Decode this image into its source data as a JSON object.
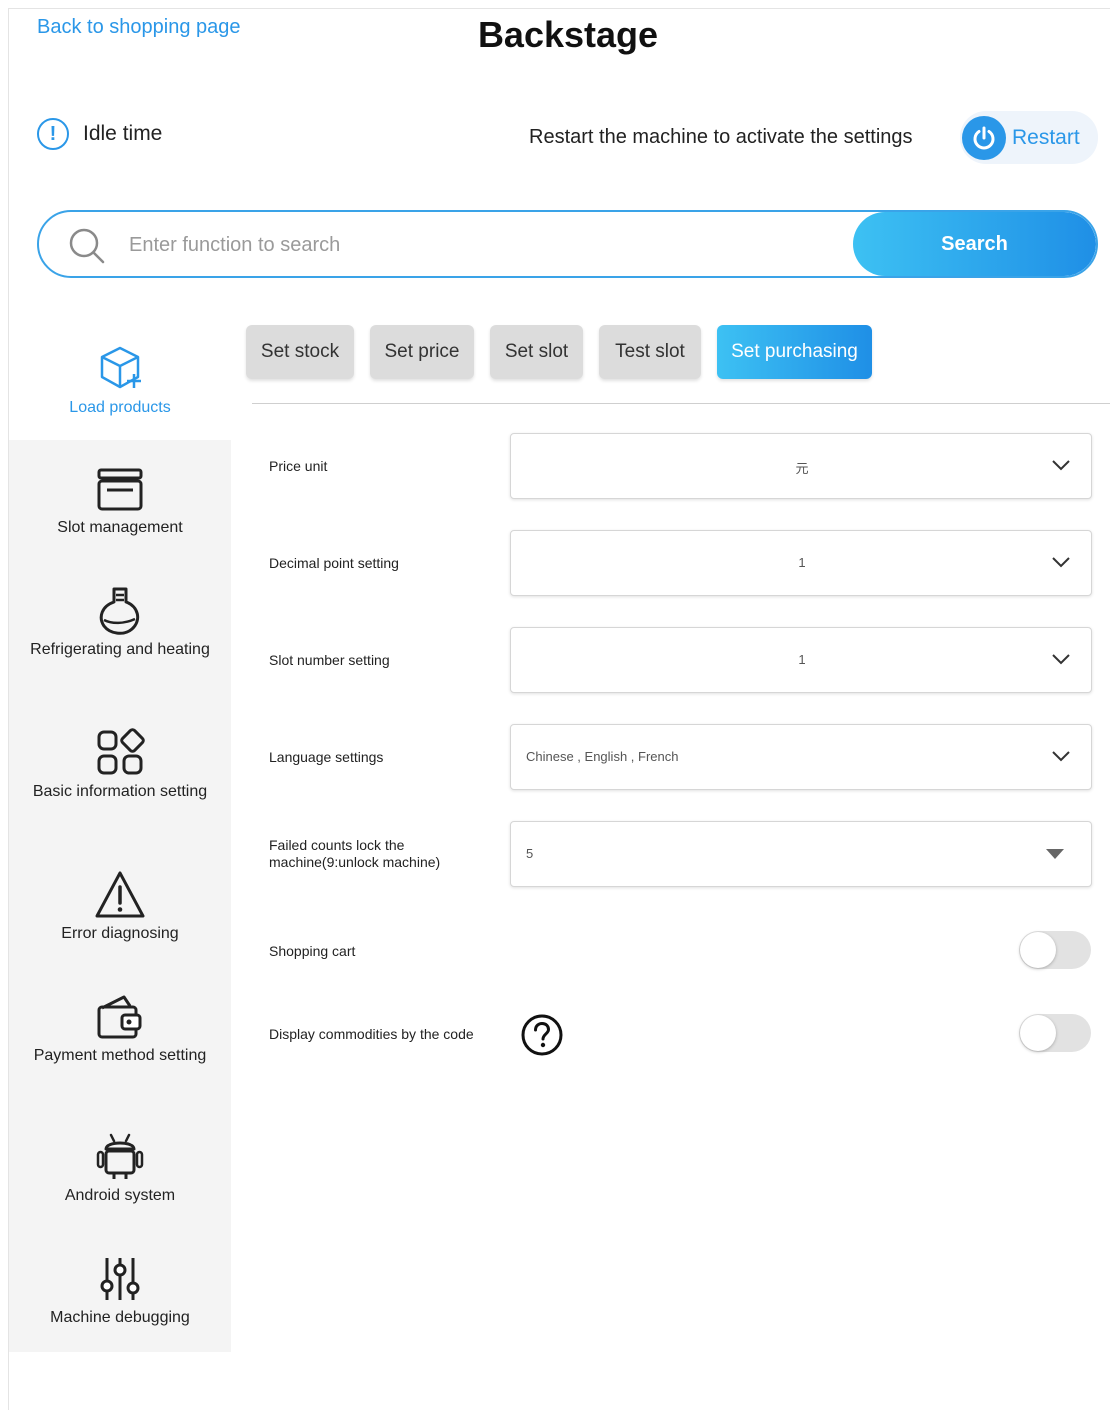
{
  "header": {
    "back_link": "Back to shopping page",
    "title": "Backstage"
  },
  "status": {
    "idle_text": "Idle time",
    "restart_note": "Restart the machine to activate the settings",
    "restart_label": "Restart"
  },
  "search": {
    "placeholder": "Enter function to search",
    "button_label": "Search"
  },
  "sidebar": {
    "items": [
      {
        "label": "Load products",
        "icon": "box-plus-icon",
        "active": true
      },
      {
        "label": "Slot management",
        "icon": "archive-icon"
      },
      {
        "label": "Refrigerating and heating",
        "icon": "flask-icon"
      },
      {
        "label": "Basic information setting",
        "icon": "apps-grid-icon"
      },
      {
        "label": "Error diagnosing",
        "icon": "warning-icon"
      },
      {
        "label": "Payment method setting",
        "icon": "wallet-icon"
      },
      {
        "label": "Android system",
        "icon": "android-icon"
      },
      {
        "label": "Machine debugging",
        "icon": "sliders-icon"
      }
    ]
  },
  "tabs": [
    {
      "label": "Set stock"
    },
    {
      "label": "Set price"
    },
    {
      "label": "Set slot"
    },
    {
      "label": "Test slot"
    },
    {
      "label": "Set purchasing",
      "active": true
    }
  ],
  "settings": {
    "price_unit": {
      "label": "Price unit",
      "value": "元"
    },
    "decimal_point": {
      "label": "Decimal point setting",
      "value": "1"
    },
    "slot_number": {
      "label": "Slot number setting",
      "value": "1"
    },
    "language": {
      "label": "Language settings",
      "value": "Chinese , English , French"
    },
    "failed_counts": {
      "label_line1": "Failed counts lock the",
      "label_line2": "machine(9:unlock machine)",
      "value": "5"
    },
    "shopping_cart": {
      "label": "Shopping cart",
      "enabled": false
    },
    "display_by_code": {
      "label": "Display commodities by the code",
      "enabled": false
    }
  },
  "colors": {
    "accent": "#2a97e8",
    "gradient_start": "#3dc1f3",
    "gradient_end": "#1f8fe6",
    "tab_inactive": "#dcdcdc",
    "sidebar_bg": "#f4f4f4"
  }
}
